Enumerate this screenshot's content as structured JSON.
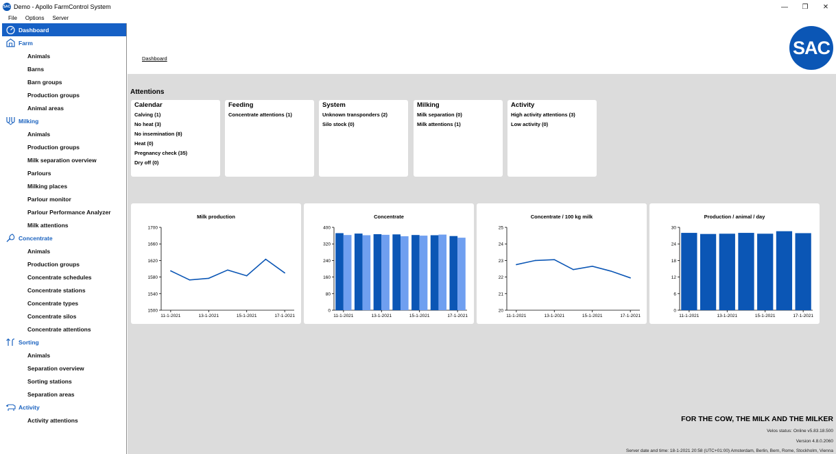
{
  "window": {
    "icon_text": "SAC",
    "title": "Demo - Apollo FarmControl System",
    "controls": [
      "—",
      "❐",
      "✕"
    ]
  },
  "menu": [
    "File",
    "Options",
    "Server"
  ],
  "sidebar": [
    {
      "label": "Dashboard",
      "icon": "gauge-icon",
      "active": true,
      "items": []
    },
    {
      "label": "Farm",
      "icon": "barn-icon",
      "items": [
        "Animals",
        "Barns",
        "Barn groups",
        "Production groups",
        "Animal areas"
      ]
    },
    {
      "label": "Milking",
      "icon": "milking-cups-icon",
      "items": [
        "Animals",
        "Production groups",
        "Milk separation overview",
        "Parlours",
        "Milking places",
        "Parlour monitor",
        "Parlour Performance Analyzer",
        "Milk attentions"
      ]
    },
    {
      "label": "Concentrate",
      "icon": "scoop-icon",
      "items": [
        "Animals",
        "Production groups",
        "Concentrate schedules",
        "Concentrate stations",
        "Concentrate types",
        "Concentrate silos",
        "Concentrate attentions"
      ]
    },
    {
      "label": "Sorting",
      "icon": "sorting-arrows-icon",
      "items": [
        "Animals",
        "Separation overview",
        "Sorting stations",
        "Separation areas"
      ]
    },
    {
      "label": "Activity",
      "icon": "cow-activity-icon",
      "items": [
        "Activity attentions"
      ]
    }
  ],
  "header": {
    "breadcrumb": "Dashboard",
    "logo_text": "SAC"
  },
  "attentions": {
    "title": "Attentions",
    "cards": [
      {
        "title": "Calendar",
        "items": [
          "Calving (1)",
          "No heat (3)",
          "No insemination (8)",
          "Heat (0)",
          "Pregnancy check (35)",
          "Dry off (0)"
        ]
      },
      {
        "title": "Feeding",
        "items": [
          "Concentrate attentions (1)"
        ]
      },
      {
        "title": "System",
        "items": [
          "Unknown transponders (2)",
          "Silo stock (0)"
        ]
      },
      {
        "title": "Milking",
        "items": [
          "Milk separation (0)",
          "Milk attentions (1)"
        ]
      },
      {
        "title": "Activity",
        "items": [
          "High activity attentions (3)",
          "Low activity (0)"
        ]
      }
    ]
  },
  "colors": {
    "primary": "#0b56b5",
    "secondary": "#6f9ff0",
    "nav_text": "#1a62bf",
    "background": "#dcdcdc"
  },
  "chart_data": [
    {
      "type": "line",
      "title": "Milk production",
      "x": [
        "11-1-2021",
        "12-1-2021",
        "13-1-2021",
        "14-1-2021",
        "15-1-2021",
        "16-1-2021",
        "17-1-2021"
      ],
      "xticks": [
        "11-1-2021",
        "13-1-2021",
        "15-1-2021",
        "17-1-2021"
      ],
      "series": [
        {
          "values": [
            1595,
            1573,
            1577,
            1597,
            1583,
            1623,
            1590
          ]
        }
      ],
      "ylim": [
        1500,
        1700
      ],
      "yticks": [
        1500,
        1540,
        1580,
        1620,
        1660,
        1700
      ]
    },
    {
      "type": "bar",
      "title": "Concentrate",
      "categories": [
        "11-1-2021",
        "12-1-2021",
        "13-1-2021",
        "14-1-2021",
        "15-1-2021",
        "16-1-2021",
        "17-1-2021"
      ],
      "xticks": [
        "11-1-2021",
        "13-1-2021",
        "15-1-2021",
        "17-1-2021"
      ],
      "series": [
        {
          "values": [
            372,
            370,
            367,
            366,
            363,
            362,
            358
          ]
        },
        {
          "values": [
            363,
            362,
            364,
            357,
            360,
            365,
            350
          ]
        }
      ],
      "ylim": [
        0,
        400
      ],
      "yticks": [
        0,
        80,
        160,
        240,
        320,
        400
      ]
    },
    {
      "type": "line",
      "title": "Concentrate / 100 kg milk",
      "x": [
        "11-1-2021",
        "12-1-2021",
        "13-1-2021",
        "14-1-2021",
        "15-1-2021",
        "16-1-2021",
        "17-1-2021"
      ],
      "xticks": [
        "11-1-2021",
        "13-1-2021",
        "15-1-2021",
        "17-1-2021"
      ],
      "series": [
        {
          "values": [
            22.75,
            23.0,
            23.05,
            22.45,
            22.65,
            22.35,
            21.95
          ]
        }
      ],
      "ylim": [
        20,
        25
      ],
      "yticks": [
        20,
        21,
        22,
        23,
        24,
        25
      ]
    },
    {
      "type": "bar",
      "title": "Production / animal / day",
      "categories": [
        "11-1-2021",
        "12-1-2021",
        "13-1-2021",
        "14-1-2021",
        "15-1-2021",
        "16-1-2021",
        "17-1-2021"
      ],
      "xticks": [
        "11-1-2021",
        "13-1-2021",
        "15-1-2021",
        "17-1-2021"
      ],
      "series": [
        {
          "values": [
            28.0,
            27.6,
            27.7,
            28.0,
            27.7,
            28.6,
            27.9
          ]
        }
      ],
      "ylim": [
        0,
        30
      ],
      "yticks": [
        0,
        6,
        12,
        18,
        24,
        30
      ]
    }
  ],
  "footer": {
    "slogan": "FOR THE COW, THE MILK AND THE MILKER",
    "velos_status": "Velos status: Online v5.83.18.500",
    "version": "Version 4.8.0.2060",
    "server_time": "Server date and time: 18-1-2021 20:58 (UTC+01:00) Amsterdam, Berlin, Bern, Rome, Stockholm, Vienna"
  }
}
